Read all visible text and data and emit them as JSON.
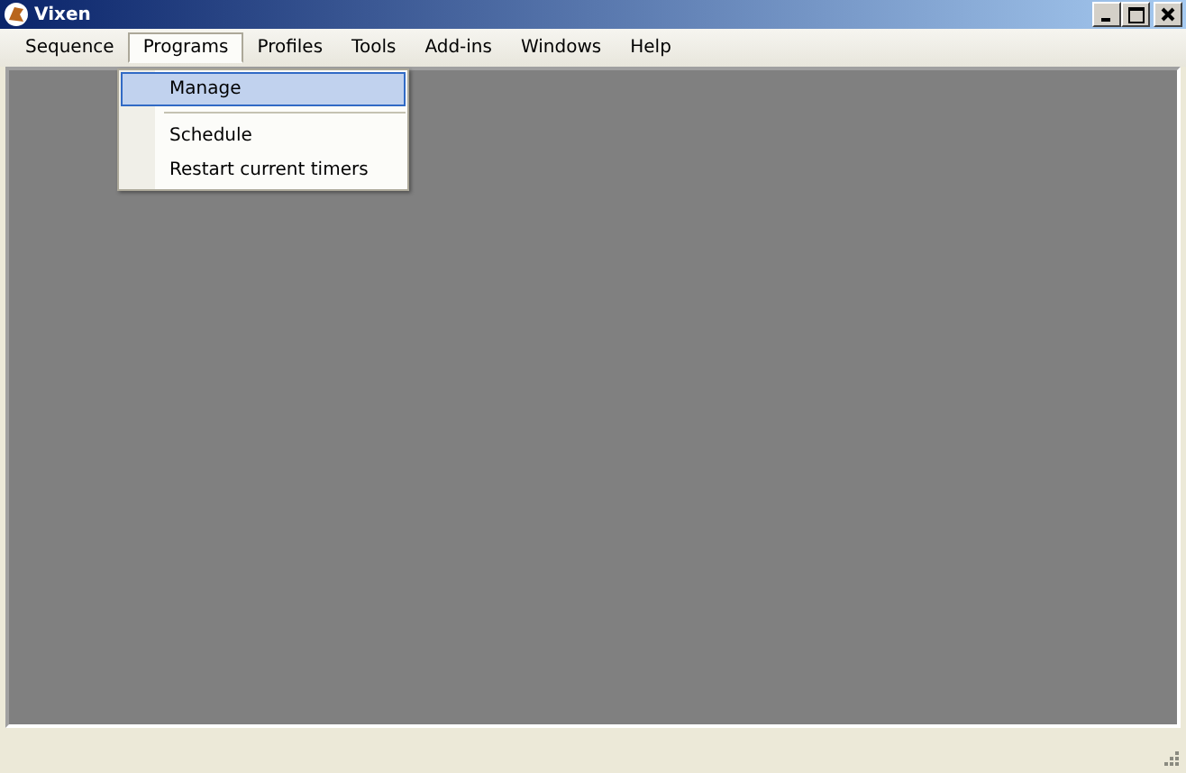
{
  "window": {
    "title": "Vixen"
  },
  "menu": [
    {
      "label": "Sequence",
      "selected": false
    },
    {
      "label": "Programs",
      "selected": true
    },
    {
      "label": "Profiles",
      "selected": false
    },
    {
      "label": "Tools",
      "selected": false
    },
    {
      "label": "Add-ins",
      "selected": false
    },
    {
      "label": "Windows",
      "selected": false
    },
    {
      "label": "Help",
      "selected": false
    }
  ],
  "dropdown": [
    {
      "kind": "item",
      "label": "Manage",
      "selected": true
    },
    {
      "kind": "separator"
    },
    {
      "kind": "item",
      "label": "Schedule",
      "selected": false
    },
    {
      "kind": "item",
      "label": "Restart current timers",
      "selected": false
    }
  ]
}
